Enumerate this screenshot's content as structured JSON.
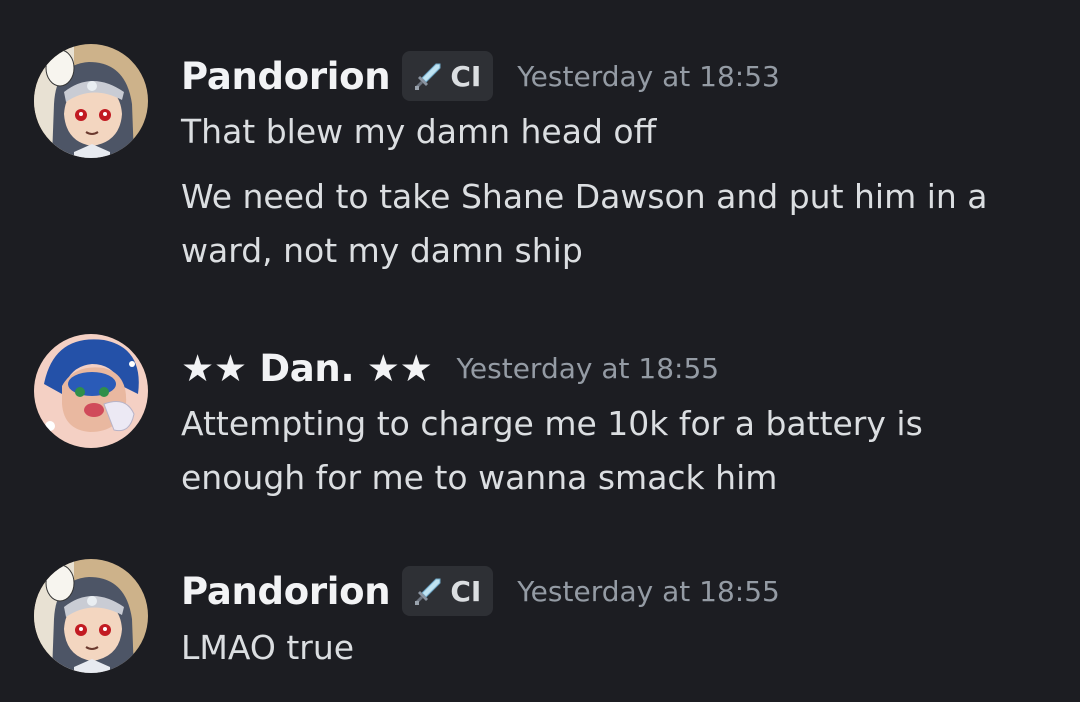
{
  "messages": [
    {
      "username": "Pandorion",
      "tag": {
        "icon": "sword-icon",
        "label": "CI"
      },
      "timestamp": "Yesterday at 18:53",
      "lines": [
        "That blew my damn head off",
        "We need to take Shane Dawson and put him in a ward, not my damn ship"
      ]
    },
    {
      "username": "★★ Dan. ★★",
      "timestamp": "Yesterday at 18:55",
      "lines": [
        "Attempting to charge me 10k for a battery is enough for me to wanna smack him"
      ]
    },
    {
      "username": "Pandorion",
      "tag": {
        "icon": "sword-icon",
        "label": "CI"
      },
      "timestamp": "Yesterday at 18:55",
      "lines": [
        "LMAO true"
      ]
    }
  ],
  "colors": {
    "background": "#1c1d22",
    "username": "#f2f3f5",
    "message_text": "#dbdee1",
    "timestamp": "#949ba4",
    "tag_background": "#2e3035"
  }
}
